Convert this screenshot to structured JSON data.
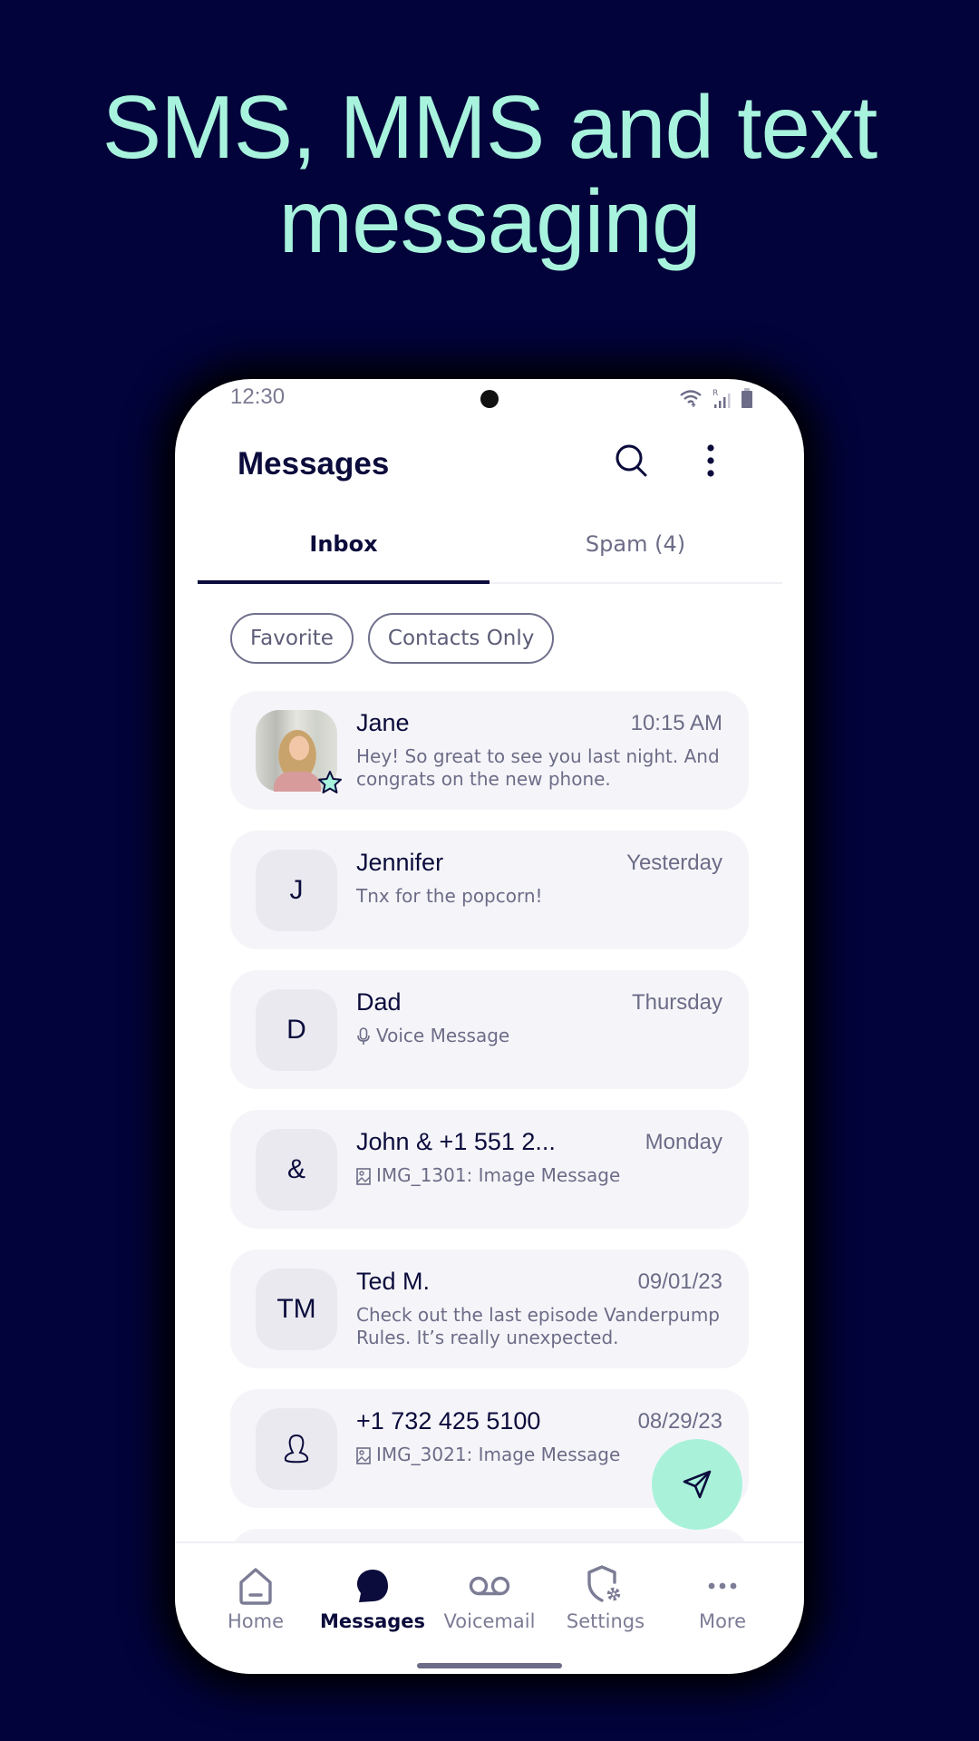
{
  "headline": {
    "line1": "SMS, MMS and text",
    "line2": "messaging",
    "color": "#a8f3dd"
  },
  "status_bar": {
    "time": "12:30",
    "icons": [
      "wifi-icon",
      "signal-icon",
      "battery-icon"
    ],
    "roaming_label": "R"
  },
  "header": {
    "title": "Messages",
    "search_icon": "search-icon",
    "menu_icon": "more-vert-icon"
  },
  "tabs": [
    {
      "label": "Inbox",
      "active": true
    },
    {
      "label": "Spam (4)",
      "active": false
    }
  ],
  "filters": [
    {
      "label": "Favorite"
    },
    {
      "label": "Contacts Only"
    }
  ],
  "conversations": [
    {
      "name": "Jane",
      "time": "10:15 AM",
      "avatar_type": "photo",
      "favorite": true,
      "preview": "Hey! So great to see you last night. And congrats on the new phone.",
      "preview_icon": null
    },
    {
      "name": "Jennifer",
      "time": "Yesterday",
      "avatar_type": "initials",
      "initials": "J",
      "preview": "Tnx for the popcorn!",
      "preview_icon": null
    },
    {
      "name": "Dad",
      "time": "Thursday",
      "avatar_type": "initials",
      "initials": "D",
      "preview": "Voice Message",
      "preview_icon": "microphone-icon"
    },
    {
      "name": "John & +1 551 2...",
      "time": "Monday",
      "avatar_type": "initials",
      "initials": "&",
      "preview": "IMG_1301: Image Message",
      "preview_icon": "image-icon"
    },
    {
      "name": "Ted M.",
      "time": "09/01/23",
      "avatar_type": "initials",
      "initials": "TM",
      "preview": "Check out the last episode Vanderpump Rules. It’s really unexpected.",
      "preview_icon": null
    },
    {
      "name": "+1 732 425 5100",
      "time": "08/29/23",
      "avatar_type": "person-icon",
      "preview": "IMG_3021: Image Message",
      "preview_icon": "image-icon"
    }
  ],
  "fab": {
    "icon": "send-icon",
    "color": "#a9f2d9"
  },
  "bottom_nav": [
    {
      "label": "Home",
      "icon": "home-icon",
      "active": false
    },
    {
      "label": "Messages",
      "icon": "chat-bubble-icon",
      "active": true
    },
    {
      "label": "Voicemail",
      "icon": "voicemail-icon",
      "active": false
    },
    {
      "label": "Settings",
      "icon": "shield-settings-icon",
      "active": false
    },
    {
      "label": "More",
      "icon": "more-horiz-icon",
      "active": false
    }
  ],
  "colors": {
    "background": "#02033a",
    "primary_text": "#0b0b3c",
    "secondary_text": "#6c6c88",
    "card": "#f5f5f9",
    "accent": "#a9f2d9"
  }
}
